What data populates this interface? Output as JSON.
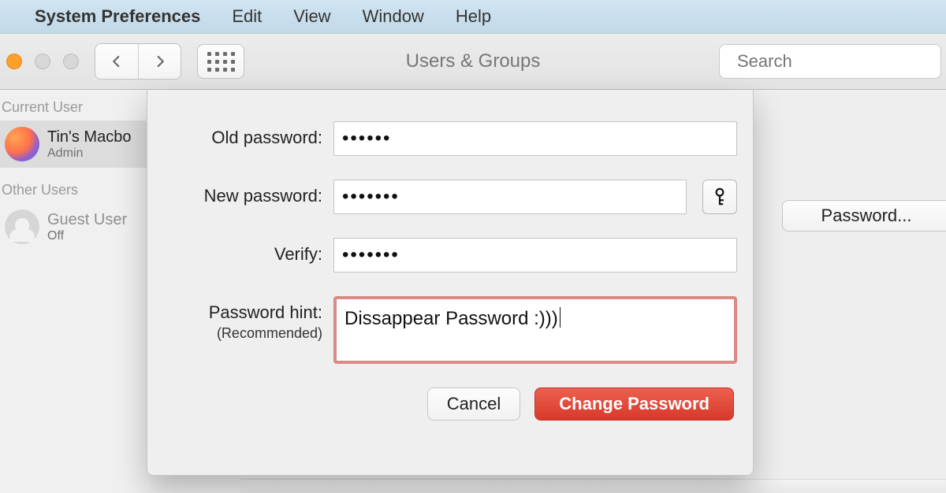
{
  "menubar": {
    "app_name": "System Preferences",
    "items": [
      "Edit",
      "View",
      "Window",
      "Help"
    ]
  },
  "toolbar": {
    "title": "Users & Groups",
    "search_placeholder": "Search"
  },
  "sidebar": {
    "current_user_section": "Current User",
    "other_users_section": "Other Users",
    "current_user": {
      "name": "Tin's Macbo",
      "role": "Admin"
    },
    "guest_user": {
      "name": "Guest User",
      "status": "Off"
    }
  },
  "side_button": {
    "label": "Password..."
  },
  "sheet": {
    "labels": {
      "old_password": "Old password:",
      "new_password": "New password:",
      "verify": "Verify:",
      "hint": "Password hint:",
      "hint_sub": "(Recommended)"
    },
    "values": {
      "old_password_mask": "••••••",
      "new_password_mask": "•••••••",
      "verify_mask": "•••••••",
      "hint_text": "Dissappear Password :)))"
    },
    "buttons": {
      "cancel": "Cancel",
      "submit": "Change Password"
    },
    "icons": {
      "key_assistant": "key-icon"
    }
  }
}
